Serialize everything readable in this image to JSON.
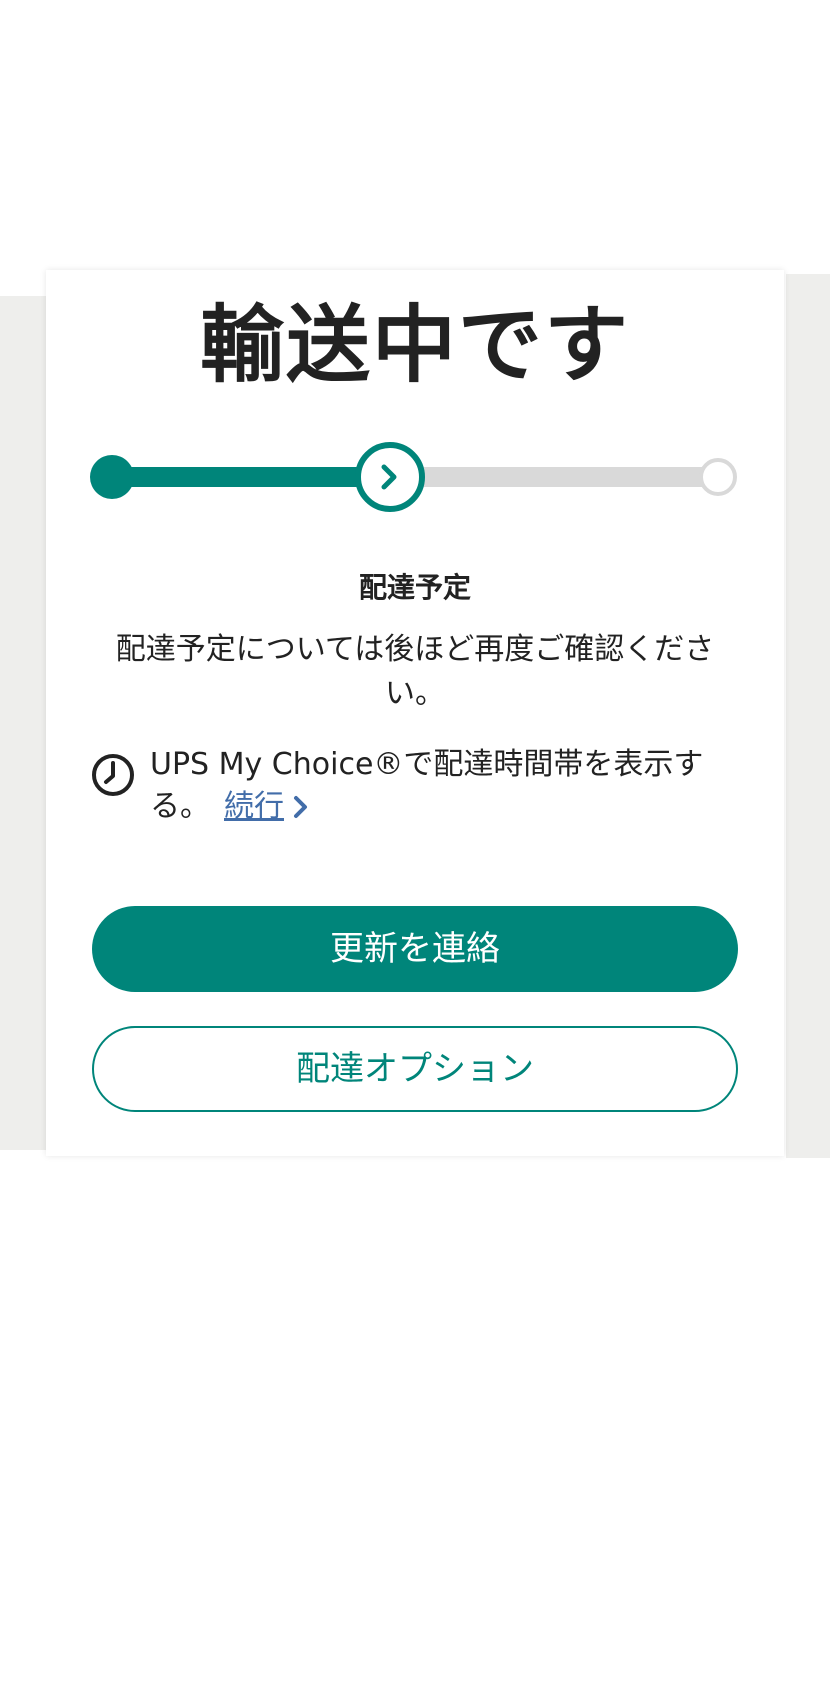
{
  "status": {
    "title": "輸送中です"
  },
  "progress": {
    "steps": [
      "completed",
      "current",
      "pending"
    ],
    "current_step_index": 1,
    "colors": {
      "active": "#00857a",
      "inactive": "#d9d9d9"
    },
    "current_icon": "chevron-right-icon"
  },
  "delivery": {
    "heading": "配達予定",
    "description": "配達予定については後ほど再度ご確認ください。"
  },
  "mychoice": {
    "icon": "clock-icon",
    "text": "UPS My Choice®で配達時間帯を表示する。",
    "link_label": "続行",
    "link_icon": "chevron-right-icon",
    "link_color": "#426da9"
  },
  "actions": {
    "primary_label": "更新を連絡",
    "secondary_label": "配達オプション",
    "accent_color": "#00857a"
  }
}
